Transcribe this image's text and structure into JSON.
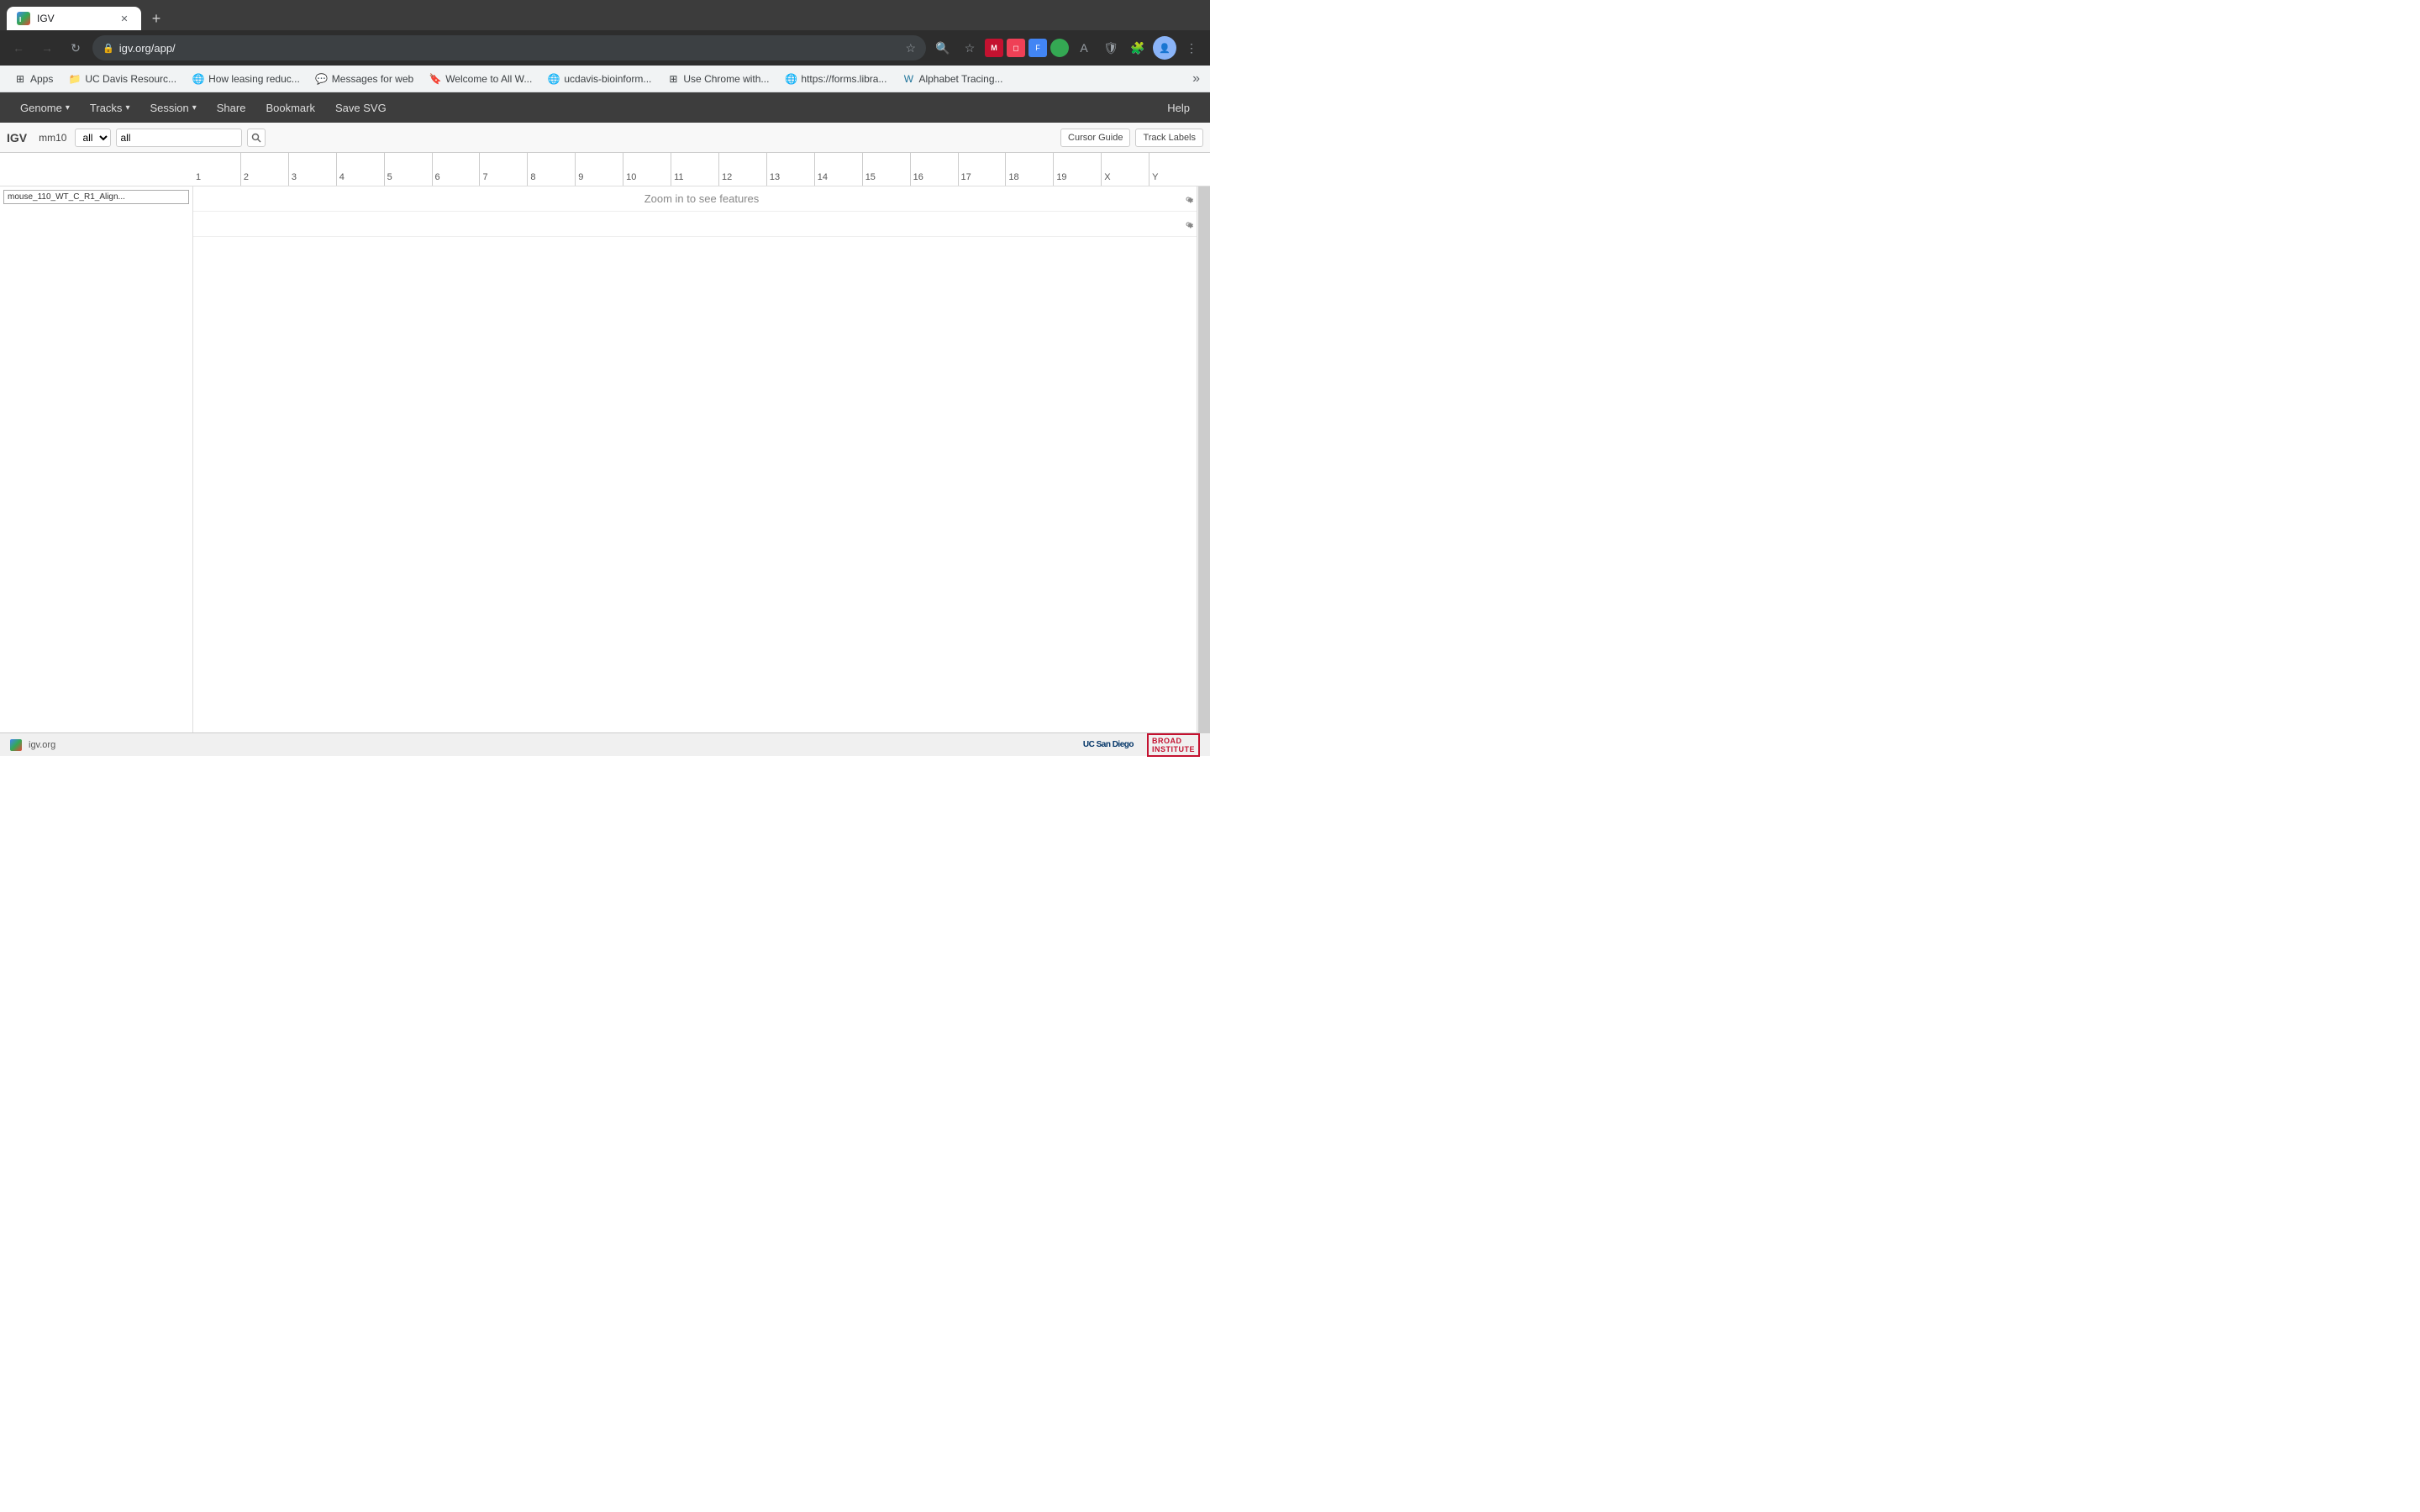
{
  "browser": {
    "tab": {
      "title": "IGV",
      "favicon_text": "IGV"
    },
    "address": "igv.org/app/",
    "bookmarks": [
      {
        "id": "apps",
        "label": "Apps",
        "icon": "grid"
      },
      {
        "id": "uc-davis",
        "label": "UC Davis Resourc...",
        "icon": "folder"
      },
      {
        "id": "how-leasing",
        "label": "How leasing reduc...",
        "icon": "globe"
      },
      {
        "id": "messages",
        "label": "Messages for web",
        "icon": "messages"
      },
      {
        "id": "welcome",
        "label": "Welcome to All W...",
        "icon": "bookmark-blue"
      },
      {
        "id": "ucdavis-bio",
        "label": "ucdavis-bioinform...",
        "icon": "globe"
      },
      {
        "id": "use-chrome",
        "label": "Use Chrome with...",
        "icon": "grid-color"
      },
      {
        "id": "forms-libra",
        "label": "https://forms.libra...",
        "icon": "globe"
      },
      {
        "id": "alphabet",
        "label": "Alphabet Tracing...",
        "icon": "wp"
      }
    ]
  },
  "igv": {
    "logo": "IGV",
    "genome": "mm10",
    "locus_dropdown": "all",
    "locus_input": "all",
    "menu": {
      "genome": "Genome",
      "tracks": "Tracks",
      "session": "Session",
      "share": "Share",
      "bookmark": "Bookmark",
      "save_svg": "Save SVG",
      "help": "Help"
    },
    "toolbar": {
      "cursor_guide": "Cursor Guide",
      "track_labels": "Track Labels"
    },
    "chromosomes": [
      "1",
      "2",
      "3",
      "4",
      "5",
      "6",
      "7",
      "8",
      "9",
      "10",
      "11",
      "12",
      "13",
      "14",
      "15",
      "16",
      "17",
      "18",
      "19",
      "X",
      "Y"
    ],
    "tracks": [
      {
        "label": "mouse_110_WT_C_R1_Align...",
        "message": "Zoom in to see features"
      }
    ]
  },
  "status_bar": {
    "site": "igv.org",
    "ucsd": "UC San Diego",
    "broad": "BROAD\nINSTITUTE"
  }
}
